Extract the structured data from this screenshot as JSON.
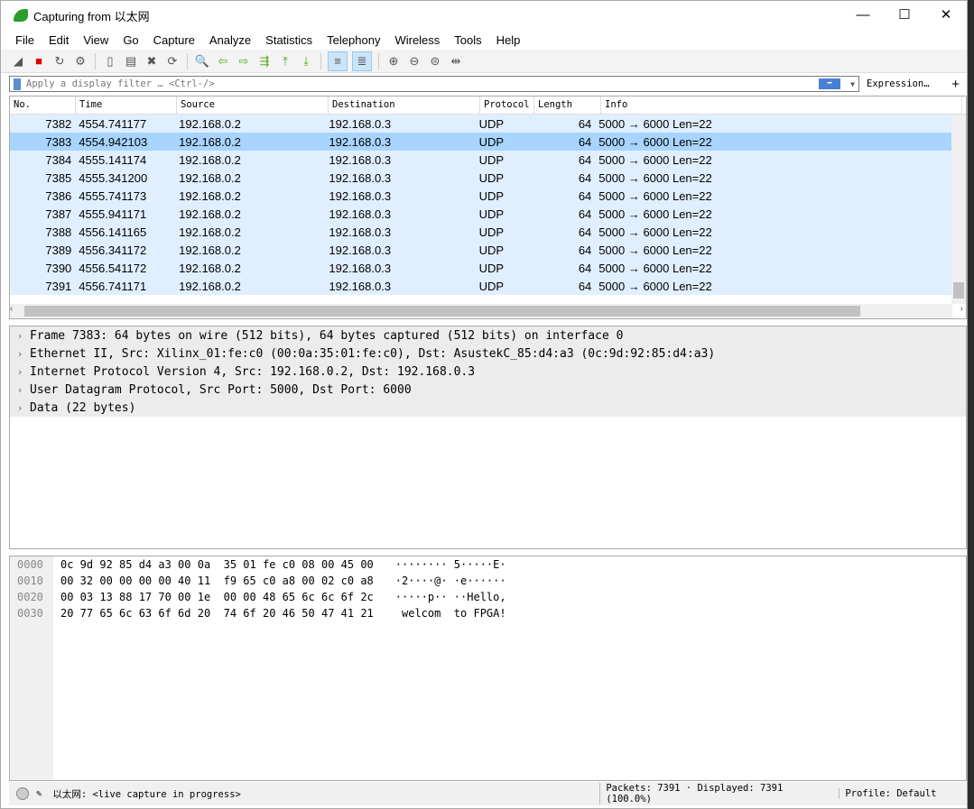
{
  "window": {
    "title": "Capturing from 以太网",
    "minimize": "—",
    "maximize": "☐",
    "close": "✕"
  },
  "menu": [
    "File",
    "Edit",
    "View",
    "Go",
    "Capture",
    "Analyze",
    "Statistics",
    "Telephony",
    "Wireless",
    "Tools",
    "Help"
  ],
  "toolbar": [
    "start-capture",
    "stop-capture",
    "restart-capture",
    "capture-options",
    "open-file",
    "save-file",
    "close-file",
    "reload-file",
    "find-packet",
    "go-back",
    "go-forward",
    "go-to-packet",
    "first-packet",
    "last-packet",
    "auto-scroll",
    "colorize",
    "zoom-in",
    "zoom-out",
    "normal-size",
    "resize-columns"
  ],
  "filter": {
    "placeholder": "Apply a display filter … <Ctrl-/>",
    "expression": "Expression…",
    "plus": "+"
  },
  "columns": [
    "No.",
    "Time",
    "Source",
    "Destination",
    "Protocol",
    "Length",
    "Info"
  ],
  "packets": [
    [
      "7382",
      "4554.741177",
      "192.168.0.2",
      "192.168.0.3",
      "UDP",
      "64",
      "5000 → 6000 Len=22"
    ],
    [
      "7383",
      "4554.942103",
      "192.168.0.2",
      "192.168.0.3",
      "UDP",
      "64",
      "5000 → 6000 Len=22"
    ],
    [
      "7384",
      "4555.141174",
      "192.168.0.2",
      "192.168.0.3",
      "UDP",
      "64",
      "5000 → 6000 Len=22"
    ],
    [
      "7385",
      "4555.341200",
      "192.168.0.2",
      "192.168.0.3",
      "UDP",
      "64",
      "5000 → 6000 Len=22"
    ],
    [
      "7386",
      "4555.741173",
      "192.168.0.2",
      "192.168.0.3",
      "UDP",
      "64",
      "5000 → 6000 Len=22"
    ],
    [
      "7387",
      "4555.941171",
      "192.168.0.2",
      "192.168.0.3",
      "UDP",
      "64",
      "5000 → 6000 Len=22"
    ],
    [
      "7388",
      "4556.141165",
      "192.168.0.2",
      "192.168.0.3",
      "UDP",
      "64",
      "5000 → 6000 Len=22"
    ],
    [
      "7389",
      "4556.341172",
      "192.168.0.2",
      "192.168.0.3",
      "UDP",
      "64",
      "5000 → 6000 Len=22"
    ],
    [
      "7390",
      "4556.541172",
      "192.168.0.2",
      "192.168.0.3",
      "UDP",
      "64",
      "5000 → 6000 Len=22"
    ],
    [
      "7391",
      "4556.741171",
      "192.168.0.2",
      "192.168.0.3",
      "UDP",
      "64",
      "5000 → 6000 Len=22"
    ]
  ],
  "selected_packet": "7383",
  "details": [
    "Frame 7383: 64 bytes on wire (512 bits), 64 bytes captured (512 bits) on interface 0",
    "Ethernet II, Src: Xilinx_01:fe:c0 (00:0a:35:01:fe:c0), Dst: AsustekC_85:d4:a3 (0c:9d:92:85:d4:a3)",
    "Internet Protocol Version 4, Src: 192.168.0.2, Dst: 192.168.0.3",
    "User Datagram Protocol, Src Port: 5000, Dst Port: 6000",
    "Data (22 bytes)"
  ],
  "hex": {
    "offsets": [
      "0000",
      "0010",
      "0020",
      "0030"
    ],
    "bytes": [
      "0c 9d 92 85 d4 a3 00 0a  35 01 fe c0 08 00 45 00",
      "00 32 00 00 00 00 40 11  f9 65 c0 a8 00 02 c0 a8",
      "00 03 13 88 17 70 00 1e  00 00 48 65 6c 6c 6f 2c",
      "20 77 65 6c 63 6f 6d 20  74 6f 20 46 50 47 41 21"
    ],
    "ascii": [
      "········ 5·····E·",
      "·2····@· ·e······",
      "·····p·· ··Hello,",
      " welcom  to FPGA!"
    ]
  },
  "status": {
    "interface": "以太网: <live capture in progress>",
    "packets": "Packets: 7391 · Displayed: 7391 (100.0%)",
    "profile": "Profile: Default"
  }
}
